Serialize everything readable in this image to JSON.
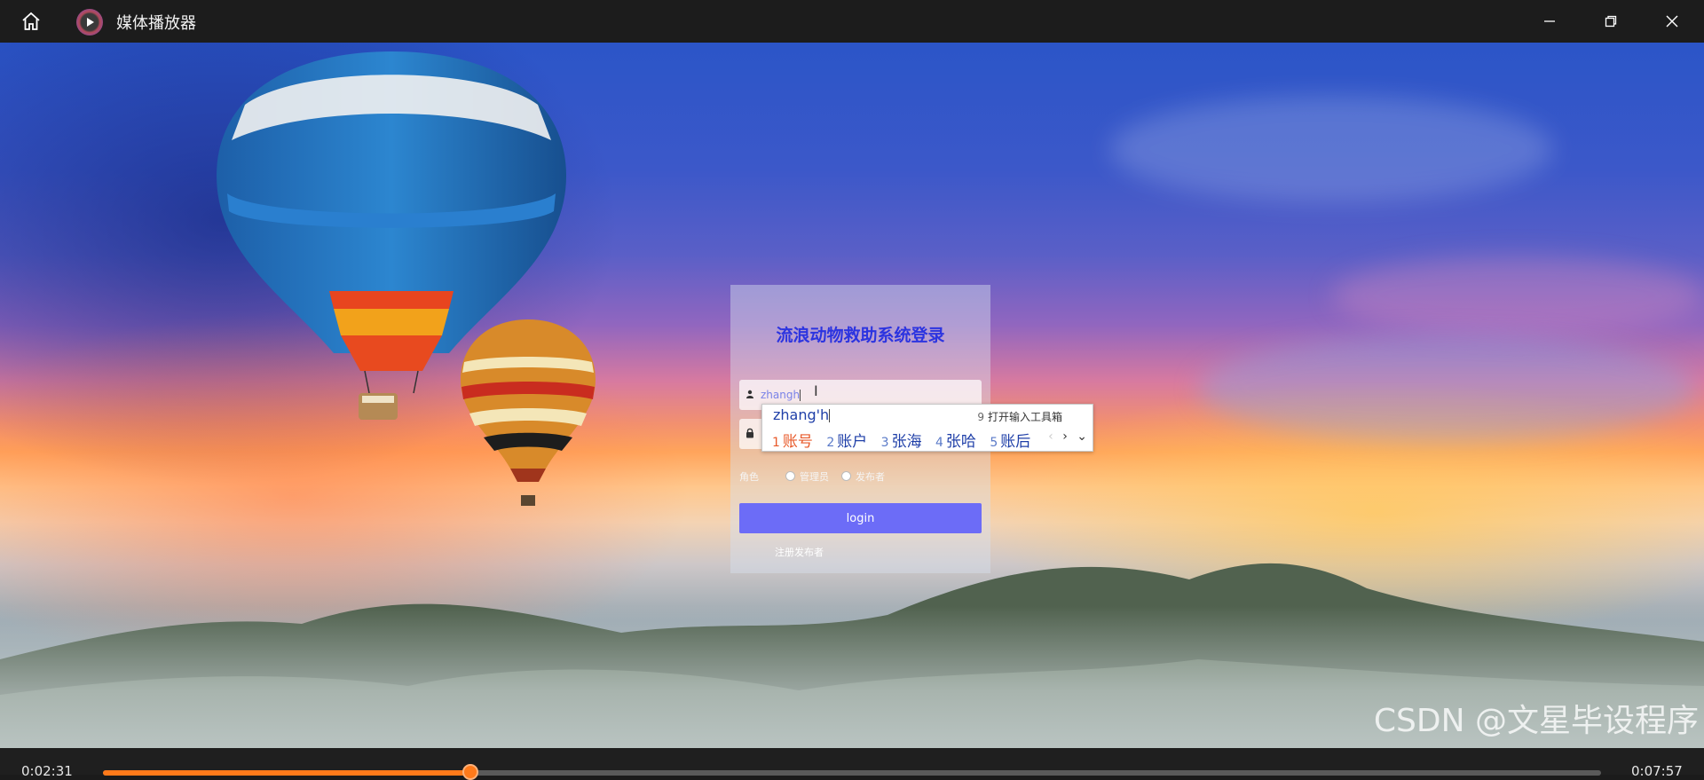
{
  "window": {
    "title": "媒体播放器",
    "controls": [
      "minimize",
      "restore",
      "close"
    ]
  },
  "login": {
    "title": "流浪动物救助系统登录",
    "username_value": "zhangh",
    "role_label": "角色",
    "roles": [
      {
        "label": "管理员",
        "selected": false
      },
      {
        "label": "发布者",
        "selected": false
      }
    ],
    "login_button": "login",
    "register_link": "注册发布者"
  },
  "ime": {
    "composition": "zhang'h",
    "toolbox_number": "9",
    "toolbox_label": "打开输入工具箱",
    "candidates": [
      {
        "n": "1",
        "text": "账号"
      },
      {
        "n": "2",
        "text": "账户"
      },
      {
        "n": "3",
        "text": "张海"
      },
      {
        "n": "4",
        "text": "张哈"
      },
      {
        "n": "5",
        "text": "账后"
      }
    ]
  },
  "player": {
    "current_time": "0:02:31",
    "total_time": "0:07:57",
    "progress": 0.2453
  },
  "watermark": "CSDN @文星毕设程序",
  "colors": {
    "accent": "#ff7a1a",
    "login_button": "#6c6cf7",
    "login_title": "#2c34e0"
  }
}
